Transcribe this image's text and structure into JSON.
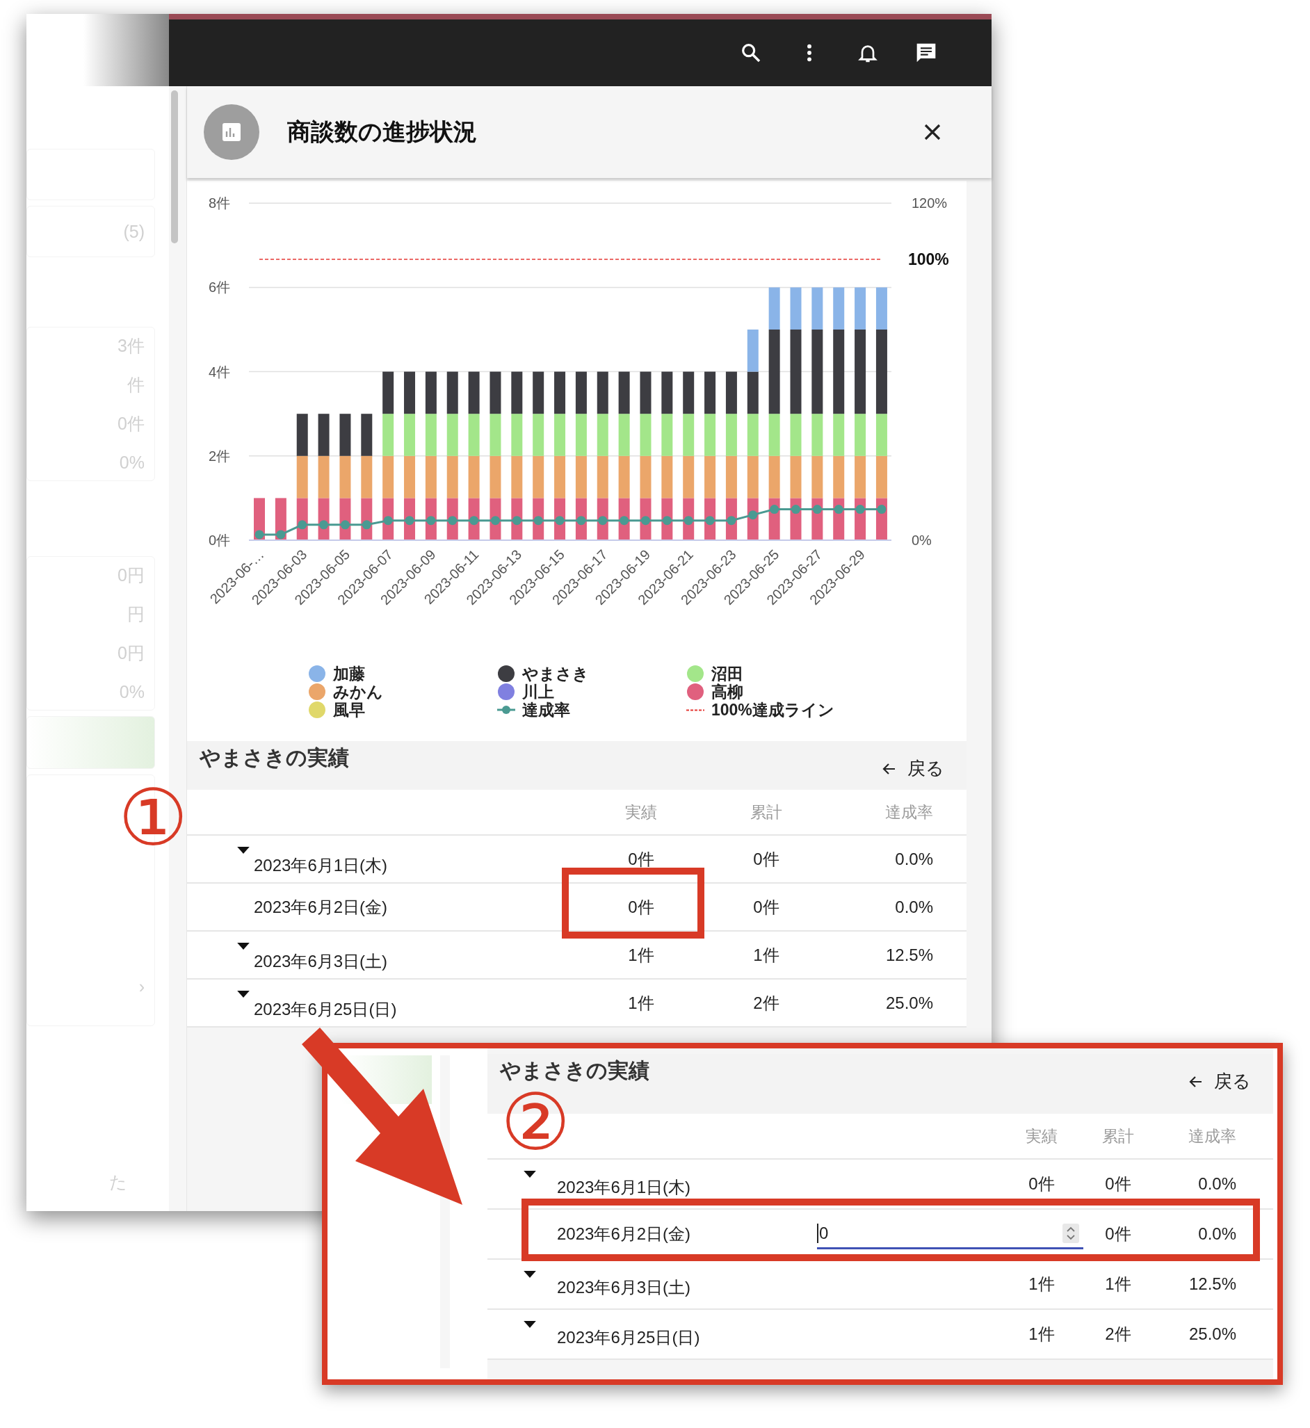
{
  "sidebar": {
    "cards": [
      {
        "kind": "blank"
      },
      {
        "kind": "text",
        "items": [
          "(5)"
        ]
      },
      {
        "kind": "text",
        "items": [
          "3件",
          "件",
          "0件",
          "0%"
        ]
      },
      {
        "kind": "text",
        "items": [
          "0円",
          "円",
          "0円",
          "0%"
        ]
      },
      {
        "kind": "highlight"
      },
      {
        "kind": "text",
        "items": [
          "›"
        ]
      }
    ],
    "footer": "た"
  },
  "dialog": {
    "title": "商談数の進捗状況",
    "chart_data": {
      "type": "bar",
      "stacked": true,
      "categories": [
        "2023-06-…",
        null,
        "2023-06-03",
        null,
        "2023-06-05",
        null,
        "2023-06-07",
        null,
        "2023-06-09",
        null,
        "2023-06-11",
        null,
        "2023-06-13",
        null,
        "2023-06-15",
        null,
        "2023-06-17",
        null,
        "2023-06-19",
        null,
        "2023-06-21",
        null,
        "2023-06-23",
        null,
        "2023-06-25",
        null,
        "2023-06-27",
        null,
        "2023-06-29",
        null
      ],
      "ylim": [
        0,
        8
      ],
      "yticks": [
        {
          "value": 0,
          "label": "0件"
        },
        {
          "value": 2,
          "label": "2件"
        },
        {
          "value": 4,
          "label": "4件"
        },
        {
          "value": 6,
          "label": "6件"
        },
        {
          "value": 8,
          "label": "8件"
        }
      ],
      "y2lim": [
        0,
        120
      ],
      "y2ticks": [
        {
          "value": 0,
          "label": "0%"
        },
        {
          "value": 120,
          "label": "120%"
        }
      ],
      "series": [
        {
          "name": "加藤",
          "color": "#8ab4e8",
          "values": [
            0,
            0,
            0,
            0,
            0,
            0,
            0,
            0,
            0,
            0,
            0,
            0,
            0,
            0,
            0,
            0,
            0,
            0,
            0,
            0,
            0,
            0,
            0,
            1,
            1,
            1,
            1,
            1,
            1,
            1
          ]
        },
        {
          "name": "みかん",
          "color": "#eba66a",
          "values": [
            0,
            0,
            1,
            1,
            1,
            1,
            1,
            1,
            1,
            1,
            1,
            1,
            1,
            1,
            1,
            1,
            1,
            1,
            1,
            1,
            1,
            1,
            1,
            1,
            1,
            1,
            1,
            1,
            1,
            1
          ]
        },
        {
          "name": "風早",
          "color": "#e0d86a",
          "values": [
            0,
            0,
            0,
            0,
            0,
            0,
            0,
            0,
            0,
            0,
            0,
            0,
            0,
            0,
            0,
            0,
            0,
            0,
            0,
            0,
            0,
            0,
            0,
            0,
            0,
            0,
            0,
            0,
            0,
            0
          ]
        },
        {
          "name": "やまさき",
          "color": "#3d3d42",
          "values": [
            0,
            0,
            1,
            1,
            1,
            1,
            1,
            1,
            1,
            1,
            1,
            1,
            1,
            1,
            1,
            1,
            1,
            1,
            1,
            1,
            1,
            1,
            1,
            1,
            2,
            2,
            2,
            2,
            2,
            2
          ]
        },
        {
          "name": "川上",
          "color": "#8080e0",
          "values": [
            0,
            0,
            0,
            0,
            0,
            0,
            0,
            0,
            0,
            0,
            0,
            0,
            0,
            0,
            0,
            0,
            0,
            0,
            0,
            0,
            0,
            0,
            0,
            0,
            0,
            0,
            0,
            0,
            0,
            0
          ]
        },
        {
          "name": "達成率",
          "color": "#4a9a92",
          "type": "line",
          "axis": "y2",
          "marker": "o",
          "values": [
            2,
            2,
            5.5,
            5.5,
            5.5,
            5.5,
            7,
            7,
            7,
            7,
            7,
            7,
            7,
            7,
            7,
            7,
            7,
            7,
            7,
            7,
            7,
            7,
            7,
            9,
            11,
            11,
            11,
            11,
            11,
            11
          ]
        },
        {
          "name": "沼田",
          "color": "#a3e68a",
          "values": [
            0,
            0,
            0,
            0,
            0,
            0,
            1,
            1,
            1,
            1,
            1,
            1,
            1,
            1,
            1,
            1,
            1,
            1,
            1,
            1,
            1,
            1,
            1,
            1,
            1,
            1,
            1,
            1,
            1,
            1
          ]
        },
        {
          "name": "高柳",
          "color": "#e0607e",
          "values": [
            1,
            1,
            1,
            1,
            1,
            1,
            1,
            1,
            1,
            1,
            1,
            1,
            1,
            1,
            1,
            1,
            1,
            1,
            1,
            1,
            1,
            1,
            1,
            1,
            1,
            1,
            1,
            1,
            1,
            1
          ]
        }
      ],
      "ref_lines": [
        {
          "label": "100%",
          "value": 100,
          "axis": "y2",
          "color": "#e53935"
        }
      ],
      "grid": true
    },
    "ref_line_legend": {
      "label": "100%達成ライン"
    }
  },
  "results": {
    "title": "やまさきの実績",
    "back": "戻る",
    "columns": [
      "実績",
      "累計",
      "達成率"
    ],
    "rows": [
      {
        "kind": "group",
        "date": "2023年6月1日(木)",
        "actual": "0件",
        "cumulative": "0件",
        "rate": "0.0%"
      },
      {
        "kind": "day",
        "date": "2023年6月2日(金)",
        "actual": "0件",
        "cumulative": "0件",
        "rate": "0.0%"
      },
      {
        "kind": "group",
        "date": "2023年6月3日(土)",
        "actual": "1件",
        "cumulative": "1件",
        "rate": "12.5%"
      },
      {
        "kind": "group",
        "date": "2023年6月25日(日)",
        "actual": "1件",
        "cumulative": "2件",
        "rate": "25.0%"
      }
    ]
  },
  "callouts": [
    {
      "label": "①"
    },
    {
      "label": "②"
    }
  ],
  "inset": {
    "title": "やまさきの実績",
    "back": "戻る",
    "columns": [
      "実績",
      "累計",
      "達成率"
    ],
    "rows": [
      {
        "kind": "group",
        "date": "2023年6月1日(木)",
        "actual": "0件",
        "cumulative": "0件",
        "rate": "0.0%"
      },
      {
        "kind": "editing",
        "date": "2023年6月2日(金)",
        "value": "0",
        "cumulative": "0件",
        "rate": "0.0%"
      },
      {
        "kind": "group",
        "date": "2023年6月3日(土)",
        "actual": "1件",
        "cumulative": "1件",
        "rate": "12.5%"
      },
      {
        "kind": "group",
        "date": "2023年6月25日(日)",
        "actual": "1件",
        "cumulative": "2件",
        "rate": "25.0%"
      }
    ]
  }
}
